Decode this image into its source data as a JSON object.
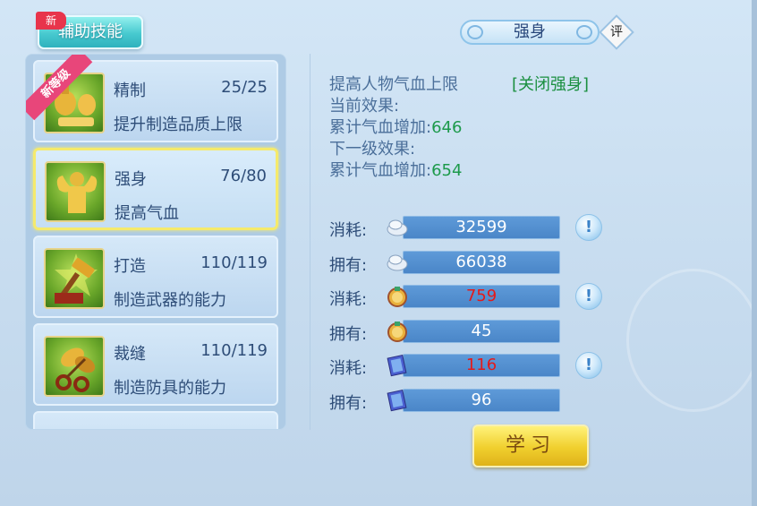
{
  "tab": {
    "label": "辅助技能",
    "badge": "新"
  },
  "skills": [
    {
      "name": "精制",
      "level": "25/25",
      "desc": "提升制造品质上限",
      "ribbon": "新等级",
      "icon": "refine-icon"
    },
    {
      "name": "强身",
      "level": "76/80",
      "desc": "提高气血",
      "icon": "muscle-icon",
      "selected": true
    },
    {
      "name": "打造",
      "level": "110/119",
      "desc": "制造武器的能力",
      "icon": "hammer-icon"
    },
    {
      "name": "裁缝",
      "level": "110/119",
      "desc": "制造防具的能力",
      "icon": "scissors-icon"
    }
  ],
  "detail": {
    "title": "强身",
    "rate_label": "评",
    "desc": "提高人物气血上限",
    "toggle_label": "[关闭强身]",
    "current_label": "当前效果:",
    "current_stat_label": "累计气血增加:",
    "current_value": "646",
    "next_label": "下一级效果:",
    "next_stat_label": "累计气血增加:",
    "next_value": "654"
  },
  "resources": [
    {
      "label": "消耗:",
      "value": "32599",
      "icon": "silver-icon",
      "red": false,
      "info": true
    },
    {
      "label": "拥有:",
      "value": "66038",
      "icon": "silver-icon",
      "red": false,
      "info": false
    },
    {
      "label": "消耗:",
      "value": "759",
      "icon": "contribution-icon",
      "red": true,
      "info": true
    },
    {
      "label": "拥有:",
      "value": "45",
      "icon": "contribution-icon",
      "red": false,
      "info": false
    },
    {
      "label": "消耗:",
      "value": "116",
      "icon": "book-icon",
      "red": true,
      "info": true
    },
    {
      "label": "拥有:",
      "value": "96",
      "icon": "book-icon",
      "red": false,
      "info": false
    }
  ],
  "learn_button": "学习",
  "colors": {
    "accent_green": "#1d9a4b",
    "warning_red": "#e41a1a",
    "button_gold": "#f0cf2d"
  }
}
